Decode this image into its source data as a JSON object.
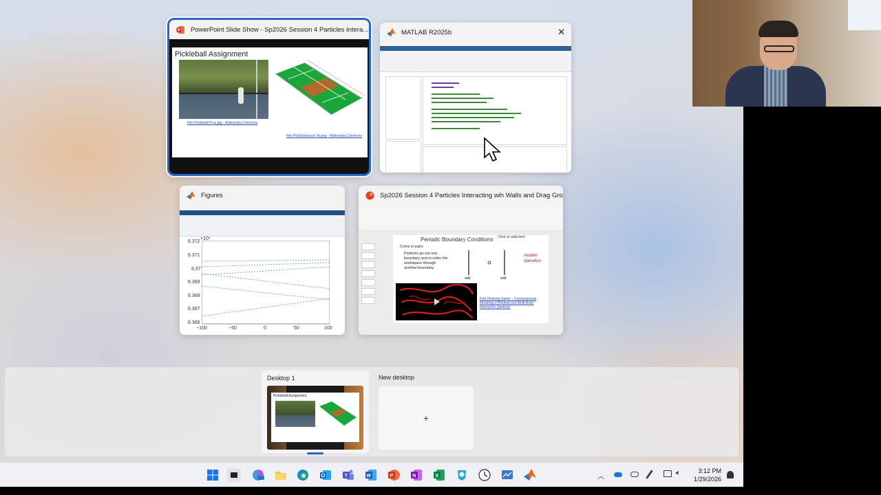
{
  "windows": {
    "powerpoint": {
      "title": "PowerPoint Slide Show  -  Sp2026 Session 4 Particles Intera...",
      "slide_title": "Pickleball Assignment",
      "photo_caption": "File:Pickleball Pros.jpg - Wikimedia Commons",
      "diagram_caption": "File:Pickleballcourt 3d.png - Wikimedia Commons"
    },
    "matlab": {
      "title": "MATLAB R2025b",
      "close_glyph": "✕"
    },
    "figures": {
      "title": "Figures",
      "exponent": "×10⁶",
      "y_ticks": [
        "6.372",
        "6.371",
        "6.37",
        "6.369",
        "6.368",
        "6.367",
        "6.366"
      ],
      "x_ticks": [
        "−100",
        "−50",
        "0",
        "50",
        "100"
      ]
    },
    "whiteboard": {
      "title": "Sp2026 Session 4 Particles Interacting wih Walls and Drag Grou...",
      "slide_title": "Periodic Boundary Conditions",
      "click_to_add": "Click to add text",
      "bullet_1": "Come in pairs",
      "bullet_2": "Particles go out one boundary and re-enter the workspace through another boundary",
      "wall_left": "wall",
      "wall_right": "wall",
      "handwritten_note": "modulo operation",
      "link_text": "Fish Flocking Game – Computational Modeling of Biofield and Multi-Body Interaction (particle)"
    }
  },
  "desktops": {
    "desktop_1_label": "Desktop 1",
    "thumb_title": "Pickleball Assignment",
    "new_desktop_label": "New desktop",
    "new_desktop_plus": "+"
  },
  "taskbar": {
    "time": "3:12 PM",
    "date": "1/29/2026",
    "icons": [
      "windows-start-icon",
      "task-view-icon",
      "copilot-icon",
      "file-explorer-icon",
      "edge-icon",
      "outlook-icon",
      "teams-icon",
      "word-icon",
      "powerpoint-icon",
      "onenote-icon",
      "excel-icon",
      "app-icon",
      "clock-icon",
      "whiteboard-icon",
      "matlab-icon"
    ]
  },
  "colors": {
    "selection": "#2b63c6",
    "court_green": "#1aa63a",
    "matlab_blue": "#2f5f94",
    "powerpoint_red": "#c43e1c"
  }
}
